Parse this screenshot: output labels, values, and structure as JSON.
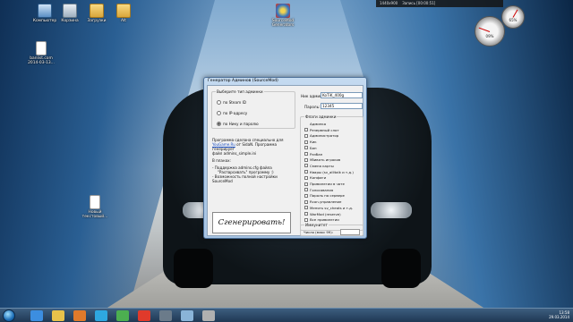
{
  "desktop": {
    "icons": [
      {
        "label": "Компьютер",
        "icon": "computer-icon"
      },
      {
        "label": "Корзина",
        "icon": "recycle-bin-icon"
      },
      {
        "label": "Загрузки",
        "icon": "folder-icon"
      },
      {
        "label": "Alt",
        "icon": "folder-icon"
      },
      {
        "label": "SourceMod Generators",
        "icon": "sourcemod-icon"
      },
      {
        "label": "banlist.com 2014-03-13...",
        "icon": "file-icon"
      },
      {
        "label": "Новый текстовый...",
        "icon": "text-file-icon"
      }
    ]
  },
  "gadgets": {
    "resolution": "1440x900",
    "record_label": "Запись [00:00:51]",
    "cpu_value": "09%",
    "ram_value": "65%"
  },
  "dialog": {
    "title": "Генератор Админов (SourceMod)",
    "type_group": {
      "legend": "Выберите тип админки",
      "options": [
        "по Steam ID",
        "по IP-адресу",
        "по Нику и паролю"
      ],
      "selected": "по Нику и паролю"
    },
    "nick_label": "Ник админа:",
    "nick_value": "KoTiK_400g",
    "password_label": "Пароль:",
    "password_value": "12345",
    "info": {
      "line1": "Программа сделана специально для",
      "link1": "YouGame.Ru",
      "line1b": "от SidaN. Программа генерирует",
      "line2": "файл admins_simple.ini",
      "plans_header": "В планах:",
      "plan1": "- Поддержка admins.cfg файла",
      "plan2": "\"Распарсивать\" программу :)",
      "plan3": "- Возможность полной настройки SourceMod"
    },
    "generate_label": "Сгенерировать!",
    "flags_group": {
      "legend": "Флаги админки",
      "items": [
        "Админка",
        "Резервный слот",
        "Администратор",
        "Кик",
        "Бан",
        "Разбан",
        "Убивать игроков",
        "Смена карты",
        "Квары (sv_allltalk и т.д.)",
        "Конфиги",
        "Привилегии в чате",
        "Голосования",
        "Пароль на сервере",
        "Rcon-управление",
        "Менять sv_cheats и т.д.",
        "WarMod (reserve)",
        "Все привилегии"
      ]
    },
    "immunity": {
      "legend": "Иммунитет",
      "label": "Число (макс 99):",
      "value": ""
    }
  },
  "taskbar": {
    "time": "13:58",
    "date": "29.03.2014",
    "pinned": [
      "ie-icon",
      "explorer-icon",
      "media-icon",
      "skype-icon",
      "chrome-icon",
      "yandex-icon",
      "steam-icon",
      "app-icon",
      "app-icon"
    ]
  }
}
